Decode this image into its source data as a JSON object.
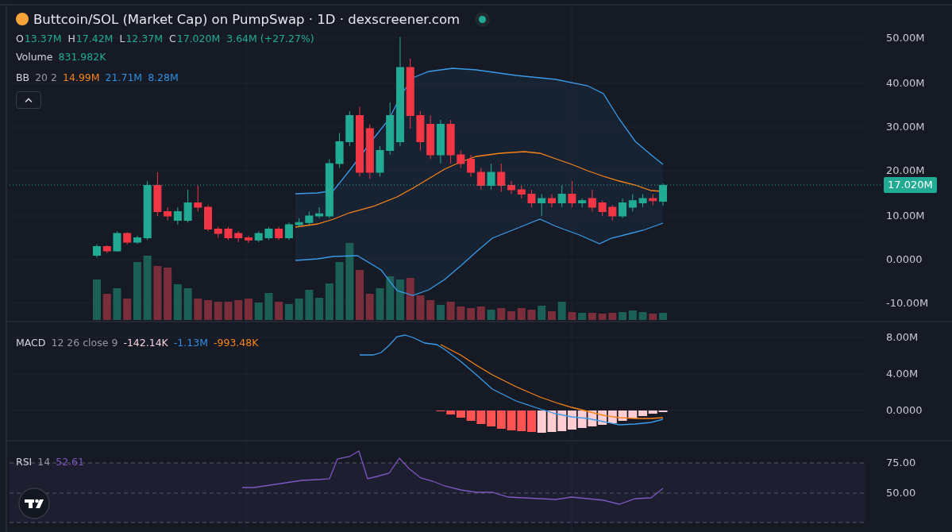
{
  "header": {
    "title": "Buttcoin/SOL (Market Cap) on PumpSwap · 1D · dexscreener.com"
  },
  "ohlc": [
    {
      "label": "O",
      "value": "13.37M"
    },
    {
      "label": "H",
      "value": "17.42M"
    },
    {
      "label": "L",
      "value": "12.37M"
    },
    {
      "label": "C",
      "value": "17.020M"
    }
  ],
  "change": "3.64M (+27.27%)",
  "volume": {
    "label": "Volume",
    "value": "831.982K"
  },
  "bb": {
    "label": "BB",
    "params": "20 2",
    "values": [
      {
        "text": "14.99M",
        "color": "#f7841b"
      },
      {
        "text": "21.71M",
        "color": "#2f8fe0"
      },
      {
        "text": "8.28M",
        "color": "#2f8fe0"
      }
    ]
  },
  "price_axis": [
    "50.00M",
    "40.00M",
    "30.00M",
    "20.00M",
    "10.00M",
    "0.0000",
    "-10.00M"
  ],
  "last_price": "17.020M",
  "macd": {
    "label": "MACD",
    "params": "12 26 close 9",
    "values": [
      {
        "text": "-142.14K",
        "color": "#f5d3dc"
      },
      {
        "text": "-1.13M",
        "color": "#2f8fe0"
      },
      {
        "text": "-993.48K",
        "color": "#f7841b"
      }
    ]
  },
  "macd_axis": [
    "8.00M",
    "4.00M",
    "0.0000"
  ],
  "rsi": {
    "label": "RSI",
    "params": "14",
    "value": "52.61"
  },
  "rsi_axis": [
    "75.00",
    "50.00"
  ]
}
